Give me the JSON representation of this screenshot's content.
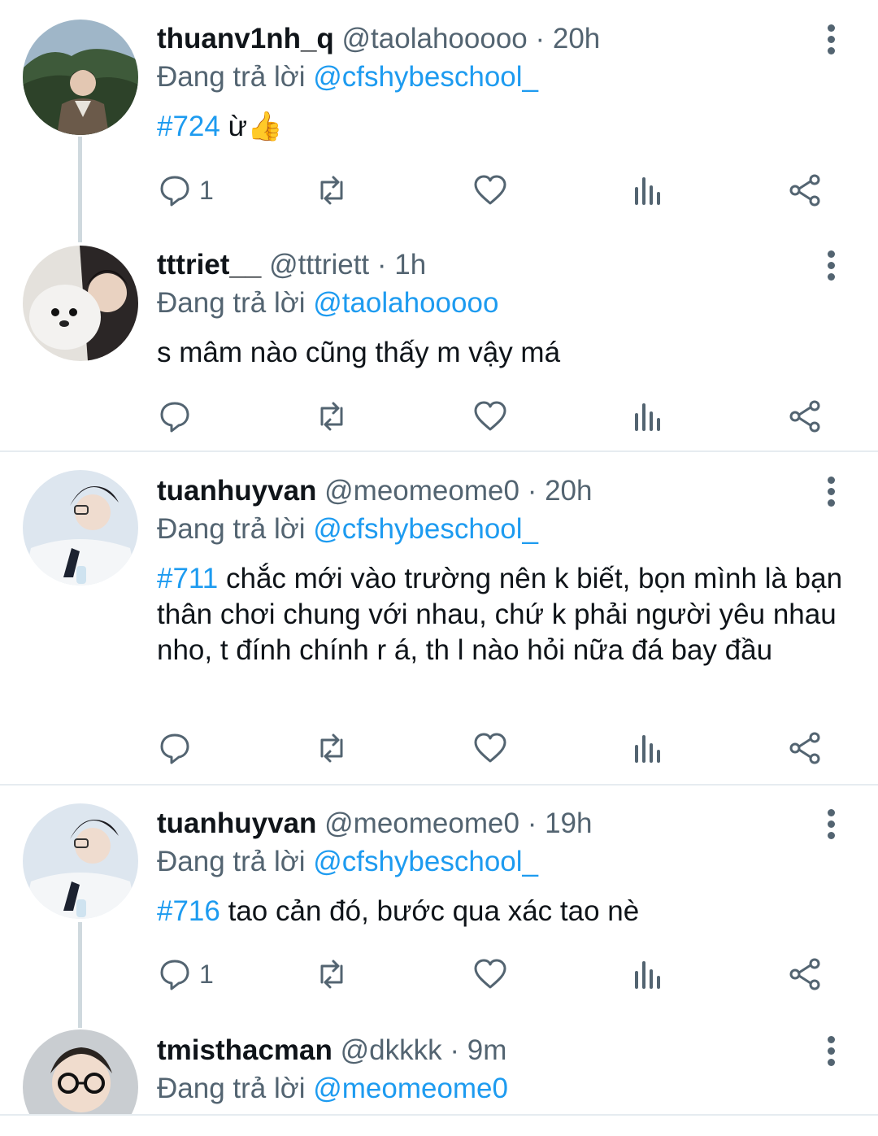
{
  "tweets": [
    {
      "username": "thuanv1nh_q",
      "handle": "@taolahooooo",
      "dot": "·",
      "time": "20h",
      "reply_prefix": "Đang trả lời ",
      "reply_to": "@cfshybeschool_",
      "hashtag": "#724",
      "text": " ừ👍",
      "reply_count": "1"
    },
    {
      "username": "tttriet__",
      "handle": "@tttriett",
      "dot": "·",
      "time": "1h",
      "reply_prefix": "Đang trả lời ",
      "reply_to": "@taolahooooo",
      "hashtag": "",
      "text": "s mâm nào cũng thấy m vậy má",
      "reply_count": ""
    },
    {
      "username": "tuanhuyvan",
      "handle": "@meomeome0",
      "dot": "·",
      "time": "20h",
      "reply_prefix": "Đang trả lời ",
      "reply_to": "@cfshybeschool_",
      "hashtag": "#711",
      "text": " chắc mới vào trường nên k biết, bọn mình là bạn thân chơi chung với nhau, chứ k phải người yêu nhau nho, t đính chính r á, th l nào hỏi nữa đá bay đầu",
      "reply_count": ""
    },
    {
      "username": "tuanhuyvan",
      "handle": "@meomeome0",
      "dot": "·",
      "time": "19h",
      "reply_prefix": "Đang trả lời ",
      "reply_to": "@cfshybeschool_",
      "hashtag": "#716",
      "text": " tao cản đó, bước qua xác tao nè",
      "reply_count": "1"
    },
    {
      "username": "tmisthacman",
      "handle": "@dkkkk",
      "dot": "·",
      "time": "9m",
      "reply_prefix": "Đang trả lời ",
      "reply_to": "@meomeome0",
      "hashtag": "",
      "text": "",
      "reply_count": ""
    }
  ],
  "icons": {
    "reply": "speech-bubble-icon",
    "retweet": "retweet-icon",
    "like": "heart-icon",
    "views": "bar-chart-icon",
    "share": "share-icon",
    "more": "vertical-dots-icon"
  },
  "colors": {
    "accent": "#1d9bf0",
    "secondary_text": "#536471",
    "primary_text": "#0f1419"
  }
}
